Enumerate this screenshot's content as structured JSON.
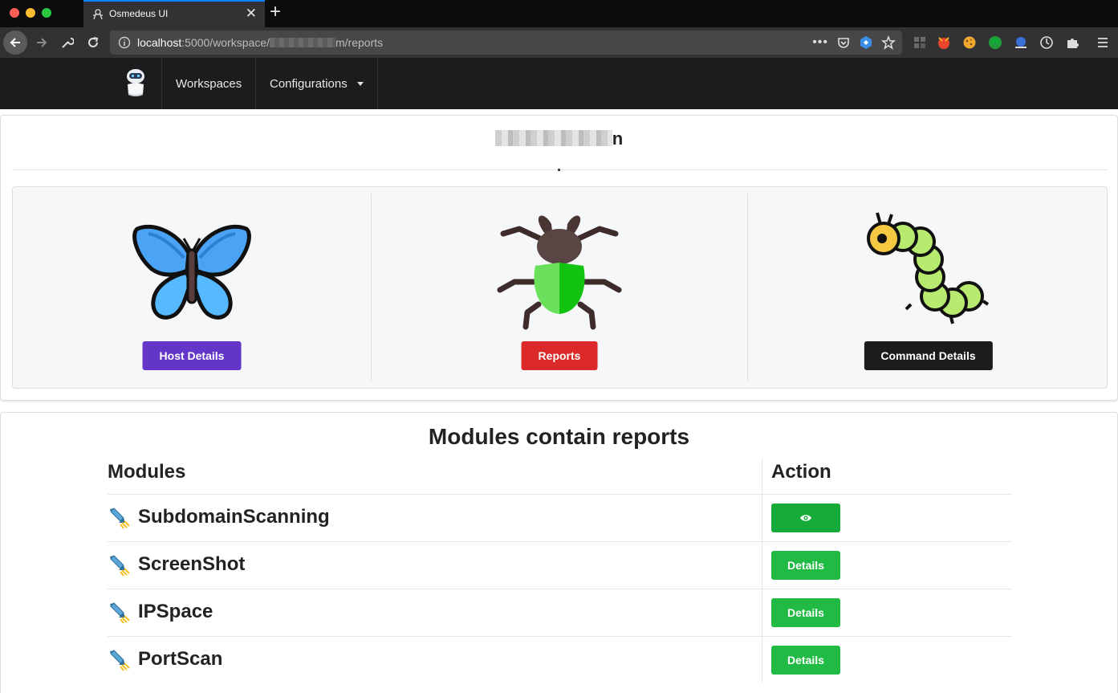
{
  "browser": {
    "tab_title": "Osmedeus UI",
    "url_host": "localhost",
    "url_path_before": ":5000/workspace/",
    "url_path_after": "m/reports"
  },
  "app_nav": {
    "items": [
      {
        "label": "Workspaces"
      },
      {
        "label": "Configurations"
      }
    ]
  },
  "workspace": {
    "title_suffix": "n"
  },
  "cards": [
    {
      "icon": "butterfly-icon",
      "button_label": "Host Details",
      "button_color": "#6435c9"
    },
    {
      "icon": "beetle-icon",
      "button_label": "Reports",
      "button_color": "#db2828"
    },
    {
      "icon": "caterpillar-icon",
      "button_label": "Command Details",
      "button_color": "#1b1c1d"
    }
  ],
  "modules": {
    "heading": "Modules contain reports",
    "columns": [
      "Modules",
      "Action"
    ],
    "rows": [
      {
        "name": "SubdomainScanning",
        "action": "",
        "action_icon": "eye-icon"
      },
      {
        "name": "ScreenShot",
        "action": "Details"
      },
      {
        "name": "IPSpace",
        "action": "Details"
      },
      {
        "name": "PortScan",
        "action": "Details"
      }
    ],
    "row_icon": "rocket-icon"
  },
  "colors": {
    "accent_green": "#21ba45",
    "nav_dark": "#1b1c1d"
  }
}
